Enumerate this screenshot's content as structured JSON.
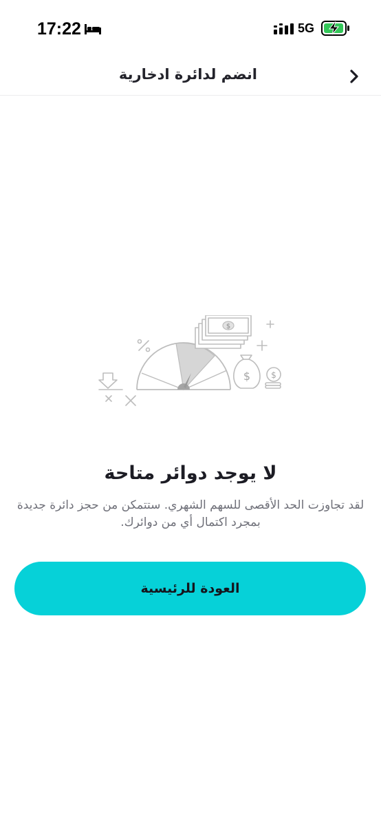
{
  "status_bar": {
    "time": "17:22",
    "network": "5G",
    "icons": [
      "bed-icon",
      "signal-icon",
      "battery-charging-icon"
    ]
  },
  "header": {
    "title": "انضم لدائرة ادخارية",
    "back_icon": "chevron-right-icon"
  },
  "empty_state": {
    "illustration": "savings-gauge-illustration",
    "title": "لا يوجد دوائر متاحة",
    "description": "لقد تجاوزت الحد الأقصى للسهم الشهري. ستتمكن من حجز دائرة جديدة بمجرد اكتمال أي من دوائرك."
  },
  "actions": {
    "home_label": "العودة للرئيسية"
  },
  "colors": {
    "accent": "#06d1d8",
    "text_primary": "#1c1c24",
    "text_secondary": "#6e6f78",
    "illustration_stroke": "#bdbdbd",
    "illustration_fill": "#d6d6d6"
  }
}
